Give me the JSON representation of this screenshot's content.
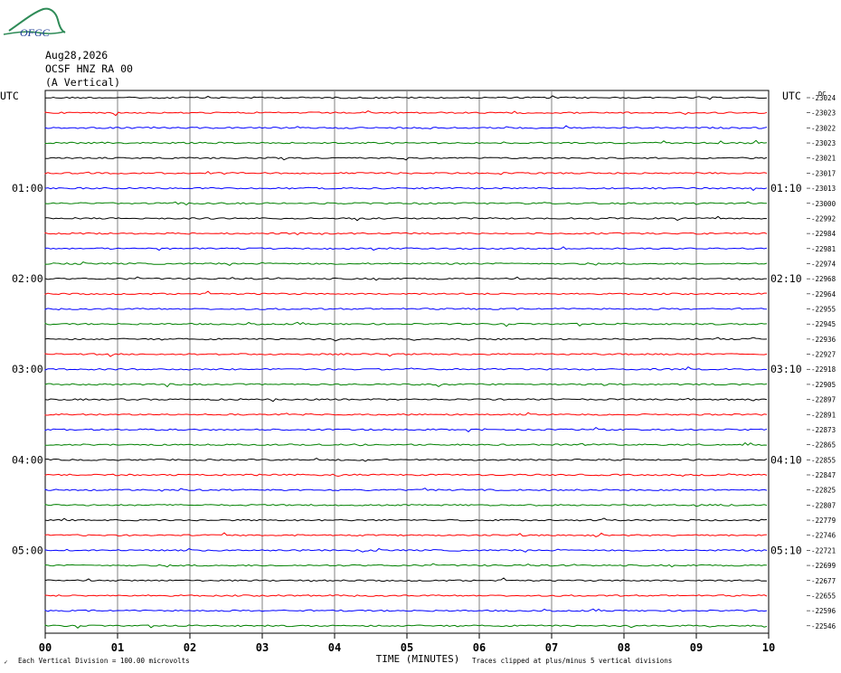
{
  "header": {
    "logo_text": "OFGC",
    "date": "Aug28,2026",
    "station": "OCSF HNZ RA 00",
    "component": "(A Vertical)"
  },
  "footer": {
    "scale_note": "Each Vertical Division =  100.00 microvolts",
    "clip_note": "Traces clipped at plus/minus 5 vertical divisions",
    "corner_glyph": "✓"
  },
  "chart_data": {
    "type": "line",
    "title": "",
    "xlabel": "TIME (MINUTES)",
    "ylabel": "",
    "x_ticks": [
      "00",
      "01",
      "02",
      "03",
      "04",
      "05",
      "06",
      "07",
      "08",
      "09",
      "10"
    ],
    "xlim": [
      0,
      10
    ],
    "left_axis_label": "UTC",
    "right_axis_label": "UTC",
    "right_axis_unit_glyph": "DC",
    "left_time_labels": [
      {
        "row": 6,
        "label": "01:00"
      },
      {
        "row": 12,
        "label": "02:00"
      },
      {
        "row": 18,
        "label": "03:00"
      },
      {
        "row": 24,
        "label": "04:00"
      },
      {
        "row": 30,
        "label": "05:00"
      }
    ],
    "right_time_labels": [
      {
        "row": 6,
        "label": "01:10"
      },
      {
        "row": 12,
        "label": "02:10"
      },
      {
        "row": 18,
        "label": "03:10"
      },
      {
        "row": 24,
        "label": "04:10"
      },
      {
        "row": 30,
        "label": "05:10"
      }
    ],
    "trace_colors": [
      "#000000",
      "#ff0000",
      "#0000ff",
      "#008000"
    ],
    "dc_offsets": [
      "-23024",
      "-23023",
      "-23022",
      "-23023",
      "-23021",
      "-23017",
      "-23013",
      "-23000",
      "-22992",
      "-22984",
      "-22981",
      "-22974",
      "-22968",
      "-22964",
      "-22955",
      "-22945",
      "-22936",
      "-22927",
      "-22918",
      "-22905",
      "-22897",
      "-22891",
      "-22873",
      "-22865",
      "-22855",
      "-22847",
      "-22825",
      "-22807",
      "-22779",
      "-22746",
      "-22721",
      "-22699",
      "-22677",
      "-22655",
      "-22596",
      "-22546"
    ],
    "grid": true
  }
}
